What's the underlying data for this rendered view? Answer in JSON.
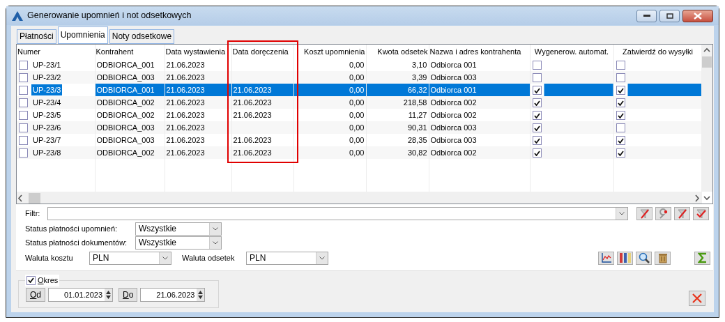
{
  "window": {
    "title": "Generowanie upomnień i not odsetkowych"
  },
  "tabs": [
    {
      "label": "Płatności",
      "selected": false
    },
    {
      "label": "Upomnienia",
      "selected": true
    },
    {
      "label": "Noty odsetkowe",
      "selected": false
    }
  ],
  "table": {
    "columns": [
      {
        "label": "Numer",
        "kind": "text"
      },
      {
        "label": "Kontrahent",
        "kind": "text"
      },
      {
        "label": "Data wystawienia",
        "kind": "text"
      },
      {
        "label": "Data doręczenia",
        "kind": "text"
      },
      {
        "label": "Koszt upomnienia",
        "kind": "amount"
      },
      {
        "label": "Kwota odsetek",
        "kind": "amount"
      },
      {
        "label": "Nazwa i adres kontrahenta",
        "kind": "text"
      },
      {
        "label": "Wygenerow. automat.",
        "kind": "check"
      },
      {
        "label": "Zatwierdź do wysyłki",
        "kind": "check"
      }
    ],
    "rows": [
      {
        "marked": false,
        "selected": false,
        "cells": [
          "UP-23/1",
          "ODBIORCA_001",
          "21.06.2023",
          "",
          "0,00",
          "3,10",
          "Odbiorca 001"
        ],
        "generated": false,
        "approved": false
      },
      {
        "marked": false,
        "selected": false,
        "cells": [
          "UP-23/2",
          "ODBIORCA_003",
          "21.06.2023",
          "",
          "0,00",
          "3,39",
          "Odbiorca 003"
        ],
        "generated": false,
        "approved": false
      },
      {
        "marked": false,
        "selected": true,
        "cells": [
          "UP-23/3",
          "ODBIORCA_001",
          "21.06.2023",
          "21.06.2023",
          "0,00",
          "66,32",
          "Odbiorca 001"
        ],
        "generated": true,
        "approved": true
      },
      {
        "marked": false,
        "selected": false,
        "cells": [
          "UP-23/4",
          "ODBIORCA_002",
          "21.06.2023",
          "21.06.2023",
          "0,00",
          "218,58",
          "Odbiorca 002"
        ],
        "generated": true,
        "approved": true
      },
      {
        "marked": false,
        "selected": false,
        "cells": [
          "UP-23/5",
          "ODBIORCA_002",
          "21.06.2023",
          "21.06.2023",
          "0,00",
          "11,27",
          "Odbiorca 002"
        ],
        "generated": true,
        "approved": true
      },
      {
        "marked": false,
        "selected": false,
        "cells": [
          "UP-23/6",
          "ODBIORCA_003",
          "21.06.2023",
          "",
          "0,00",
          "90,31",
          "Odbiorca 003"
        ],
        "generated": true,
        "approved": false
      },
      {
        "marked": false,
        "selected": false,
        "cells": [
          "UP-23/7",
          "ODBIORCA_003",
          "21.06.2023",
          "21.06.2023",
          "0,00",
          "28,35",
          "Odbiorca 003"
        ],
        "generated": true,
        "approved": true
      },
      {
        "marked": false,
        "selected": false,
        "cells": [
          "UP-23/8",
          "ODBIORCA_002",
          "21.06.2023",
          "21.06.2023",
          "0,00",
          "30,82",
          "Odbiorca 002"
        ],
        "generated": true,
        "approved": true
      }
    ]
  },
  "filter": {
    "label": "Filtr:"
  },
  "status_fields": [
    {
      "label": "Status płatności upomnień:",
      "value": "Wszystkie"
    },
    {
      "label": "Status płatności dokumentów:",
      "value": "Wszystkie"
    }
  ],
  "currency_fields": [
    {
      "label": "Waluta kosztu",
      "value": "PLN"
    },
    {
      "label": "Waluta odsetek",
      "value": "PLN"
    }
  ],
  "period": {
    "label": "Okres",
    "checked": true,
    "from": {
      "button": "Od",
      "value": "01.01.2023"
    },
    "to": {
      "button": "Do",
      "value": "21.06.2023"
    }
  }
}
